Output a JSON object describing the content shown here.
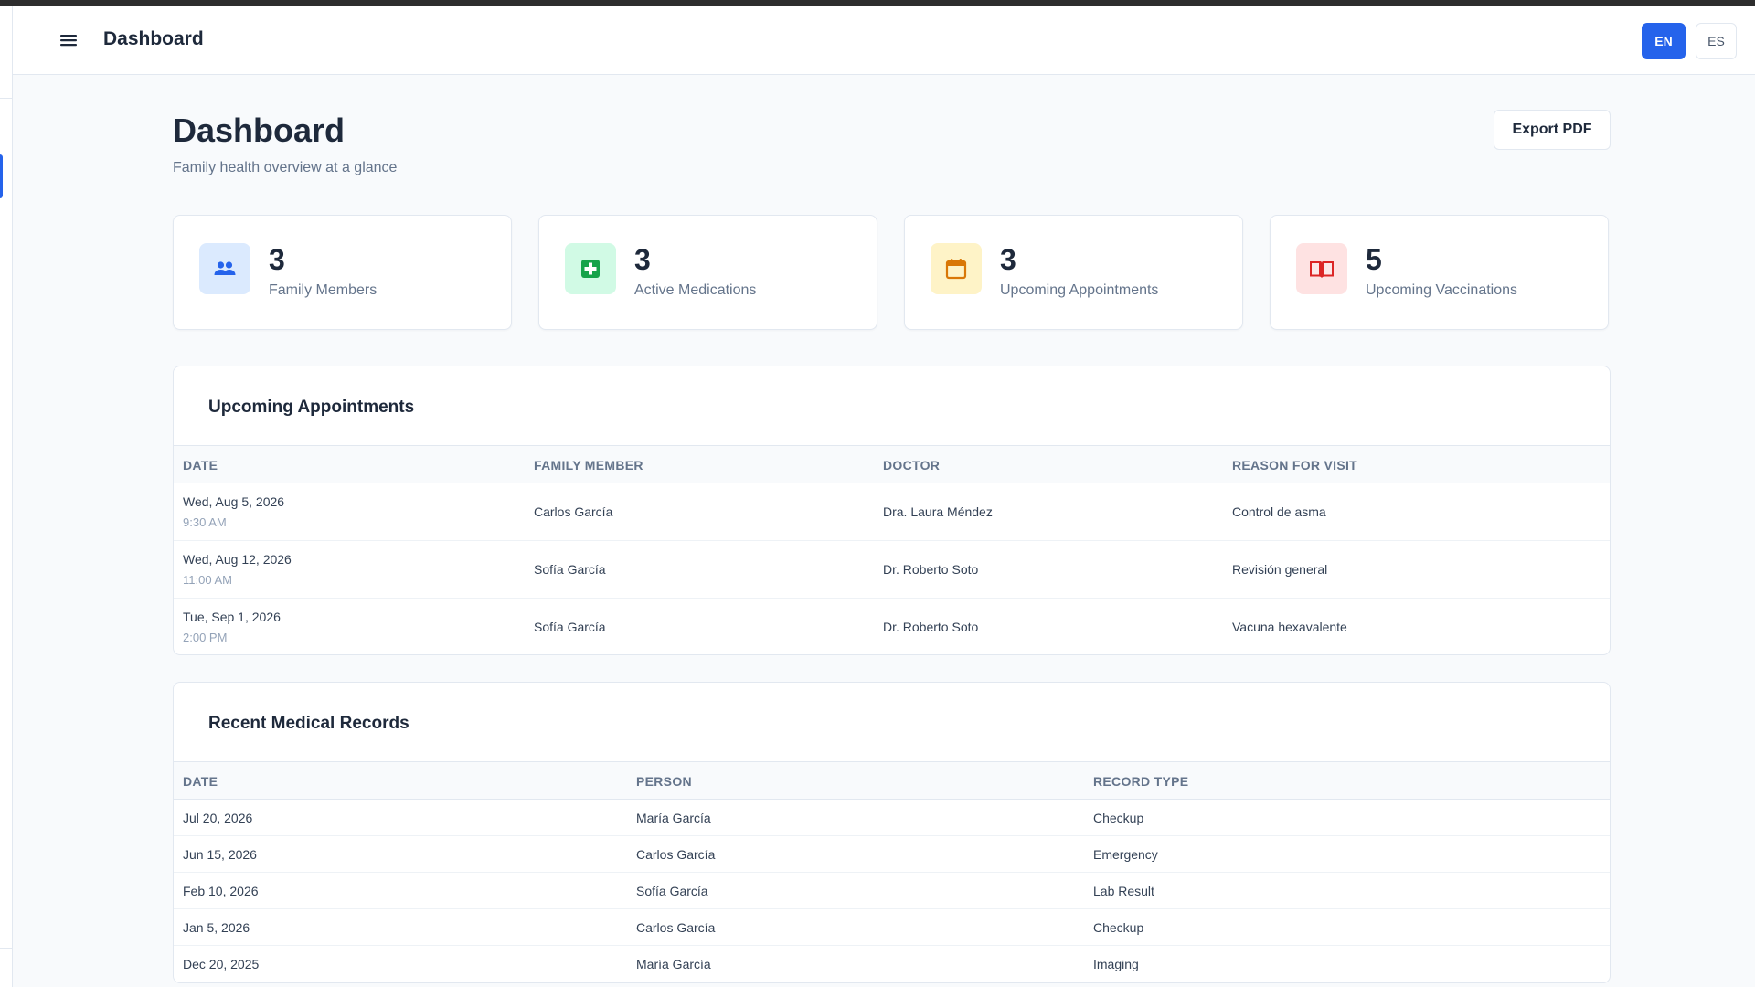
{
  "header": {
    "title": "Dashboard",
    "lang_en": "EN",
    "lang_es": "ES"
  },
  "page": {
    "title": "Dashboard",
    "subtitle": "Family health overview at a glance",
    "export_label": "Export PDF"
  },
  "stats": [
    {
      "value": "3",
      "label": "Family Members",
      "icon": "people-icon",
      "bg": "#dbeafe",
      "fg": "#2563eb"
    },
    {
      "value": "3",
      "label": "Active Medications",
      "icon": "medical-cross-icon",
      "bg": "#d1fae5",
      "fg": "#16a34a"
    },
    {
      "value": "3",
      "label": "Upcoming Appointments",
      "icon": "calendar-icon",
      "bg": "#fef3c7",
      "fg": "#d97706"
    },
    {
      "value": "5",
      "label": "Upcoming Vaccinations",
      "icon": "book-icon",
      "bg": "#fee2e2",
      "fg": "#dc2626"
    }
  ],
  "appointments": {
    "title": "Upcoming Appointments",
    "columns": [
      "DATE",
      "FAMILY MEMBER",
      "DOCTOR",
      "REASON FOR VISIT"
    ],
    "rows": [
      {
        "date": "Wed, Aug 5, 2026",
        "time": "9:30 AM",
        "member": "Carlos García",
        "doctor": "Dra. Laura Méndez",
        "reason": "Control de asma"
      },
      {
        "date": "Wed, Aug 12, 2026",
        "time": "11:00 AM",
        "member": "Sofía García",
        "doctor": "Dr. Roberto Soto",
        "reason": "Revisión general"
      },
      {
        "date": "Tue, Sep 1, 2026",
        "time": "2:00 PM",
        "member": "Sofía García",
        "doctor": "Dr. Roberto Soto",
        "reason": "Vacuna hexavalente"
      }
    ]
  },
  "records": {
    "title": "Recent Medical Records",
    "columns": [
      "DATE",
      "PERSON",
      "RECORD TYPE"
    ],
    "rows": [
      {
        "date": "Jul 20, 2026",
        "person": "María García",
        "type": "Checkup"
      },
      {
        "date": "Jun 15, 2026",
        "person": "Carlos García",
        "type": "Emergency"
      },
      {
        "date": "Feb 10, 2026",
        "person": "Sofía García",
        "type": "Lab Result"
      },
      {
        "date": "Jan 5, 2026",
        "person": "Carlos García",
        "type": "Checkup"
      },
      {
        "date": "Dec 20, 2025",
        "person": "María García",
        "type": "Imaging"
      }
    ]
  }
}
